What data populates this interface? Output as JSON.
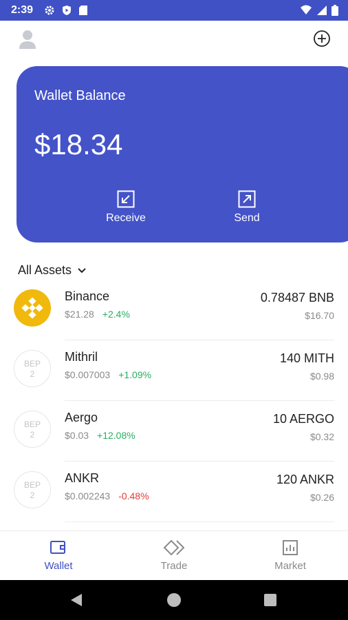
{
  "status_bar": {
    "time": "2:39",
    "icons": [
      "settings-gear-icon",
      "shield-play-icon",
      "sd-card-icon",
      "wifi-icon",
      "cellular-signal-icon",
      "battery-icon"
    ]
  },
  "header": {
    "avatar_icon": "user-avatar-icon",
    "add_icon": "plus-circle-icon"
  },
  "wallet_card": {
    "title": "Wallet Balance",
    "balance": "$18.34",
    "actions": [
      {
        "label": "Receive",
        "icon": "arrow-down-left-box-icon"
      },
      {
        "label": "Send",
        "icon": "arrow-up-right-box-icon"
      }
    ],
    "color": "#4453c8"
  },
  "assets_header": {
    "label": "All Assets",
    "icon": "chevron-down-icon"
  },
  "assets": [
    {
      "name": "Binance",
      "price": "$21.28",
      "change": "+2.4%",
      "change_dir": "pos",
      "amount": "0.78487 BNB",
      "fiat": "$16.70",
      "icon": "binance-logo-icon"
    },
    {
      "name": "Mithril",
      "price": "$0.007003",
      "change": "+1.09%",
      "change_dir": "pos",
      "amount": "140 MITH",
      "fiat": "$0.98",
      "icon_label": "BEP",
      "icon_sub": "2"
    },
    {
      "name": "Aergo",
      "price": "$0.03",
      "change": "+12.08%",
      "change_dir": "pos",
      "amount": "10 AERGO",
      "fiat": "$0.32",
      "icon_label": "BEP",
      "icon_sub": "2"
    },
    {
      "name": "ANKR",
      "price": "$0.002243",
      "change": "-0.48%",
      "change_dir": "neg",
      "amount": "120 ANKR",
      "fiat": "$0.26",
      "icon_label": "BEP",
      "icon_sub": "2"
    }
  ],
  "bottom_nav": {
    "tabs": [
      {
        "label": "Wallet",
        "icon": "wallet-icon",
        "active": true
      },
      {
        "label": "Trade",
        "icon": "trade-diamond-icon",
        "active": false
      },
      {
        "label": "Market",
        "icon": "bar-chart-icon",
        "active": false
      }
    ]
  },
  "colors": {
    "primary": "#3f51c4",
    "positive": "#27ae60",
    "negative": "#e53935",
    "binance_gold": "#f0b90b"
  }
}
